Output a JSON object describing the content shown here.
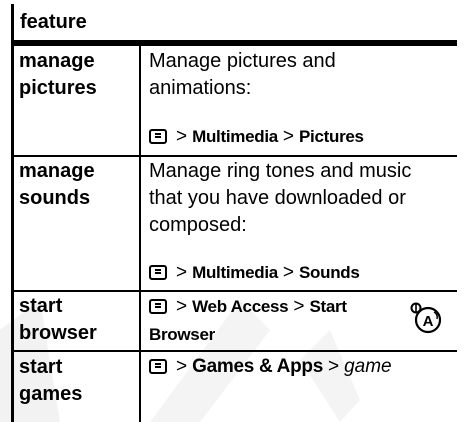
{
  "table": {
    "header": "feature",
    "rows": [
      {
        "feature_line1": "manage",
        "feature_line2": "pictures",
        "desc_line1": "Manage pictures and",
        "desc_line2": "animations:",
        "desc_line3": "",
        "path": [
          "Multimedia",
          "Pictures"
        ]
      },
      {
        "feature_line1": "manage",
        "feature_line2": "sounds",
        "desc_line1": "Manage ring tones and music",
        "desc_line2": "that you have downloaded or",
        "desc_line3": "composed:",
        "path": [
          "Multimedia",
          "Sounds"
        ]
      },
      {
        "feature_line1": "start",
        "feature_line2": "browser",
        "path": [
          "Web Access",
          "Start",
          "Browser"
        ],
        "badge_icon": "network-dependent-feature-icon"
      },
      {
        "feature_line1": "start",
        "feature_line2": "games",
        "path": [
          "Games & Apps"
        ],
        "path_italic": "game"
      }
    ],
    "separator": ">",
    "menu_key_icon": "menu-key-icon"
  }
}
